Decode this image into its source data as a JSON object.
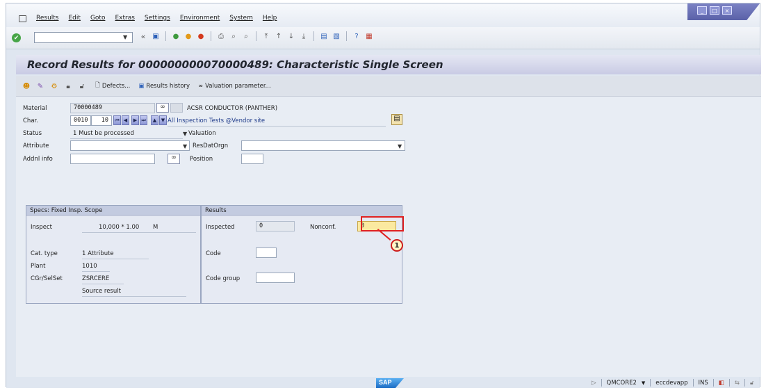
{
  "menubar": {
    "items": [
      "Results",
      "Edit",
      "Goto",
      "Extras",
      "Settings",
      "Environment",
      "System",
      "Help"
    ]
  },
  "window_controls": {
    "minimize": "_",
    "maximize": "□",
    "close": "×"
  },
  "toolbar": {
    "cmd_value": "",
    "back_chevron": "«"
  },
  "title": "Record Results for 000000000070000489: Characteristic Single Screen",
  "app_toolbar": {
    "defects": "Defects...",
    "results_history": "Results history",
    "valuation_parameter": "Valuation parameter..."
  },
  "header": {
    "material_label": "Material",
    "material_value": "70000489",
    "material_desc": "ACSR CONDUCTOR (PANTHER)",
    "char_label": "Char.",
    "char_op": "0010",
    "char_num": "10",
    "char_link": "All Inspection Tests @Vendor site",
    "status_label": "Status",
    "status_value": "1 Must be processed",
    "valuation_label": "Valuation",
    "attribute_label": "Attribute",
    "attribute_value": "",
    "resdat_label": "ResDatOrgn",
    "resdat_value": "",
    "addnl_label": "Addnl info",
    "addnl_value": "",
    "position_label": "Position",
    "position_value": ""
  },
  "specs": {
    "header": "Specs: Fixed Insp. Scope",
    "inspect_label": "Inspect",
    "inspect_value": "10,000 * 1.00",
    "inspect_unit": "M",
    "cat_label": "Cat. type",
    "cat_value": "1 Attribute",
    "plant_label": "Plant",
    "plant_value": "1010",
    "cgr_label": "CGr/SelSet",
    "cgr_value": "ZSRCERE",
    "source": "Source result"
  },
  "results": {
    "header": "Results",
    "inspected_label": "Inspected",
    "inspected_value": "0",
    "nonconf_label": "Nonconf.",
    "nonconf_value": "0",
    "code_label": "Code",
    "code_value": "",
    "codegroup_label": "Code group",
    "codegroup_value": ""
  },
  "callout": "1",
  "statusbar": {
    "logo": "SAP",
    "system": "QMCORE2",
    "server": "eccdevapp",
    "mode": "INS"
  }
}
